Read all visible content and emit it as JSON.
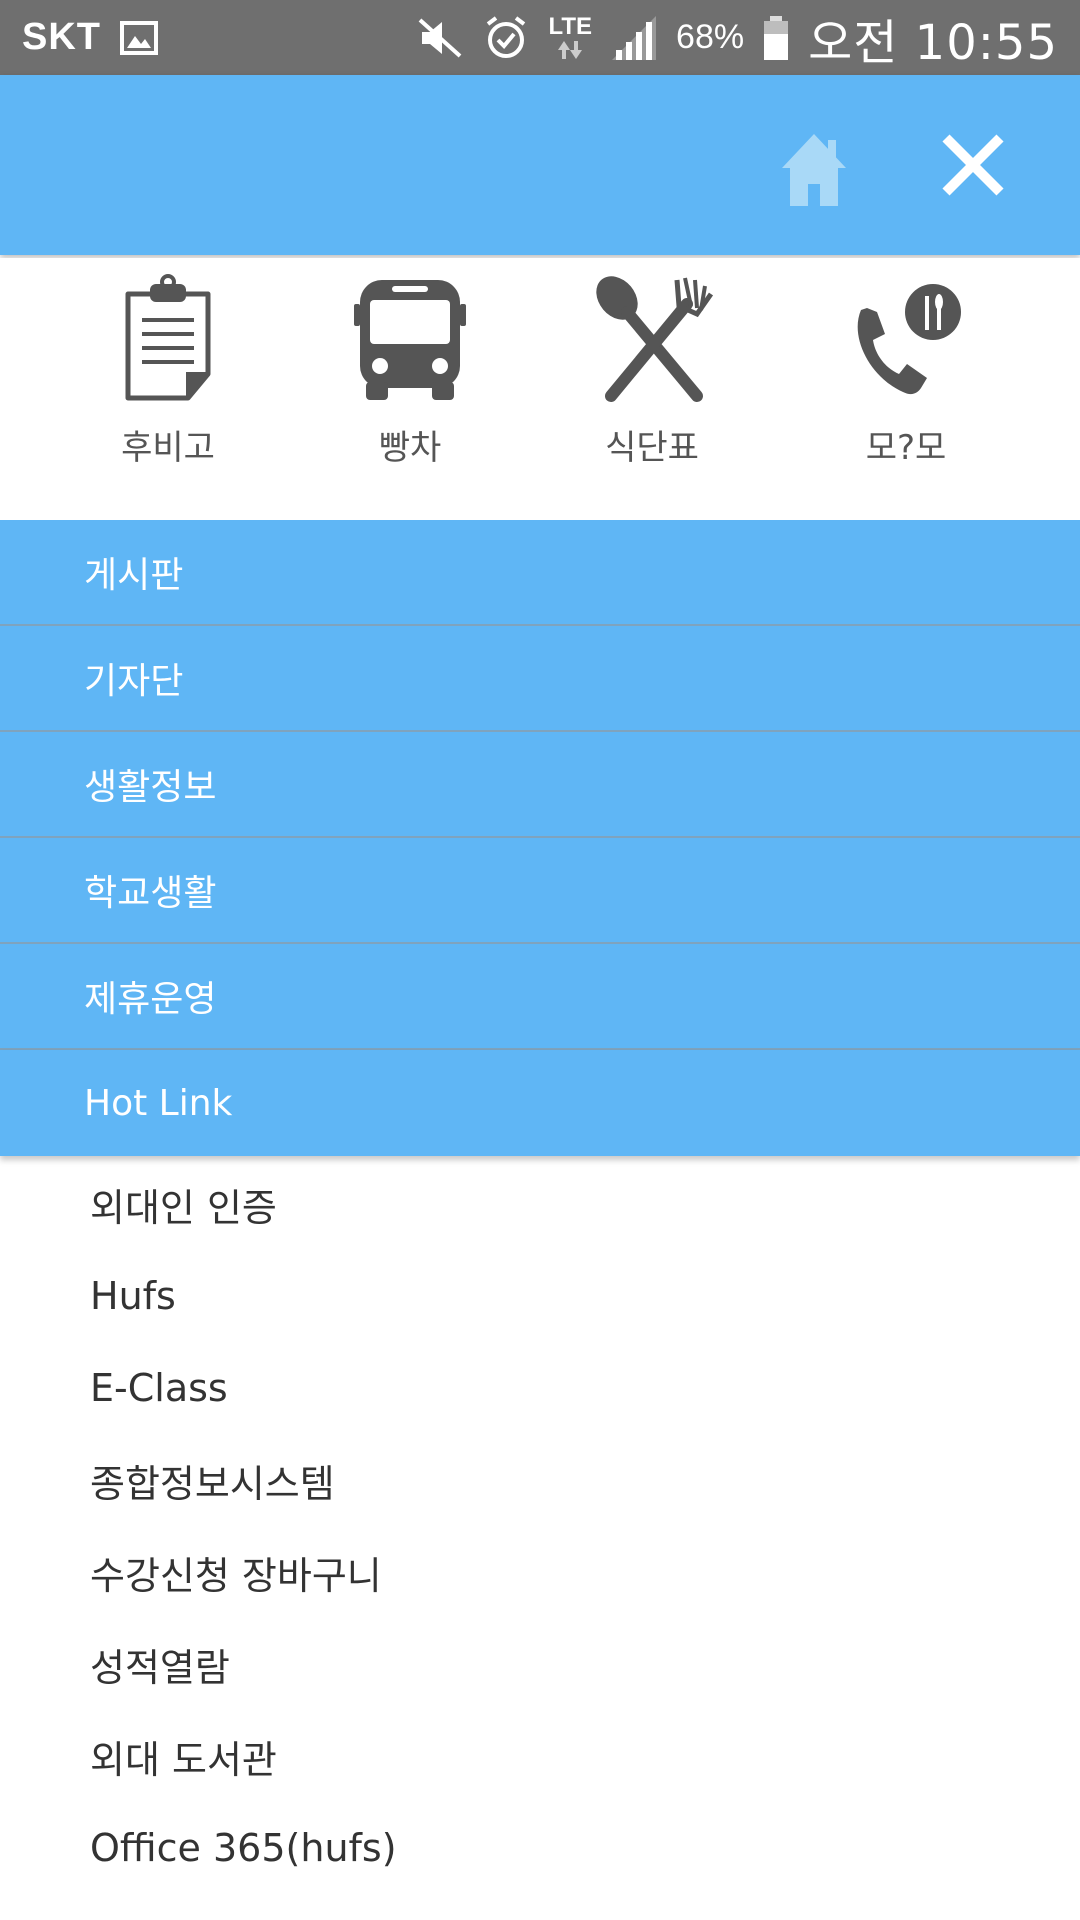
{
  "status_bar": {
    "carrier": "SKT",
    "network": "LTE",
    "battery": "68%",
    "time": "오전 10:55",
    "icons": [
      "gallery-icon",
      "mute-icon",
      "alarm-icon",
      "lte-icon",
      "signal-icon",
      "battery-icon"
    ]
  },
  "header": {
    "home_icon": "home-icon",
    "close_icon": "close-icon",
    "accent": "#5fb6f5",
    "home_color": "#9fd4f6"
  },
  "quick_menu": [
    {
      "label": "후비고",
      "icon": "clipboard-icon"
    },
    {
      "label": "빵차",
      "icon": "bus-icon"
    },
    {
      "label": "식단표",
      "icon": "spoon-fork-icon"
    },
    {
      "label": "모?모",
      "icon": "phone-icon"
    }
  ],
  "menu": [
    {
      "label": "게시판"
    },
    {
      "label": "기자단"
    },
    {
      "label": "생활정보"
    },
    {
      "label": "학교생활"
    },
    {
      "label": "제휴운영"
    },
    {
      "label": "Hot Link"
    }
  ],
  "hot_links": [
    {
      "label": "외대인 인증"
    },
    {
      "label": "Hufs"
    },
    {
      "label": "E-Class"
    },
    {
      "label": "종합정보시스템"
    },
    {
      "label": "수강신청 장바구니"
    },
    {
      "label": "성적열람"
    },
    {
      "label": "외대 도서관"
    },
    {
      "label": "Office 365(hufs)"
    }
  ]
}
